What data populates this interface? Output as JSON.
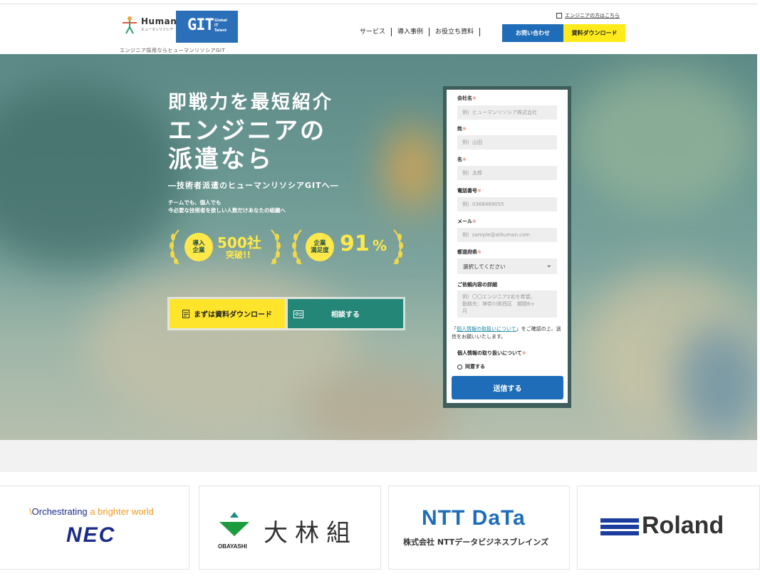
{
  "header": {
    "logo_human": {
      "word": "Human",
      "sub": "ヒューマンリソシア"
    },
    "logo_git": {
      "big": "GIT",
      "small1": "Global",
      "small2": "IT",
      "small3": "Talent"
    },
    "tagline": "エンジニア採用ならヒューマンリソシアGIT",
    "engineer_link": "エンジニアの方はこちら",
    "nav": [
      "サービス",
      "導入事例",
      "お役立ち資料"
    ],
    "contact_button": "お問い合わせ",
    "download_button": "資料ダウンロード"
  },
  "hero": {
    "title_line1": "即戦力を最短紹介",
    "title_line2": "エンジニアの",
    "title_line3": "派遣なら",
    "subtitle": "―技術者派遣のヒューマンリソシアGITへ―",
    "desc_line1": "チームでも、個人でも",
    "desc_line2": "今必要な技術者を欲しい人数だけあなたの組織へ",
    "badge1": {
      "label1": "導入",
      "label2": "企業",
      "value": "500社",
      "suffix": "突破!!"
    },
    "badge2": {
      "label1": "企業",
      "label2": "満足度",
      "value": "91",
      "unit": "%"
    },
    "cta_download": "まずは資料ダウンロード",
    "cta_consult": "相談する"
  },
  "form": {
    "company_label": "会社名",
    "company_placeholder": "例）ヒューマンリソシア株式会社",
    "last_name_label": "姓",
    "last_name_placeholder": "例）山田",
    "first_name_label": "名",
    "first_name_placeholder": "例）太郎",
    "phone_label": "電話番号",
    "phone_placeholder": "例）0368469055",
    "email_label": "メール",
    "email_placeholder": "例）sample@athuman.com",
    "pref_label": "都道府県",
    "pref_value": "選択してください",
    "detail_label": "ご依頼内容の詳細",
    "detail_placeholder_1": "例）〇〇エンジニア2名を希望。",
    "detail_placeholder_2": "勤務先：神奈川県西区　期間6ヶ",
    "detail_placeholder_3": "月",
    "required_mark": "※",
    "note_open": "「",
    "note_link": "個人情報の取扱いについて",
    "note_rest": "」をご確認の上、送信をお願いいたします。",
    "privacy_label": "個人情報の取り扱いについて",
    "agree_label": "同意する",
    "submit": "送信する"
  },
  "logos": {
    "nec_tagline": "Orchestrating a brighter world",
    "nec_tagline_accent": "a brighter world",
    "nec": "NEC",
    "obayashi_en": "OBAYASHI",
    "obayashi_jp": "大林組",
    "nttdata": "NTT DaTa",
    "nttdata_sub": "株式会社 NTTデータビジネスブレインズ",
    "roland": "Roland"
  },
  "colors": {
    "primary_blue": "#1f6db8",
    "accent_yellow": "#ffeb1b",
    "consult_green": "#248677",
    "required_red": "#e06b5a"
  }
}
